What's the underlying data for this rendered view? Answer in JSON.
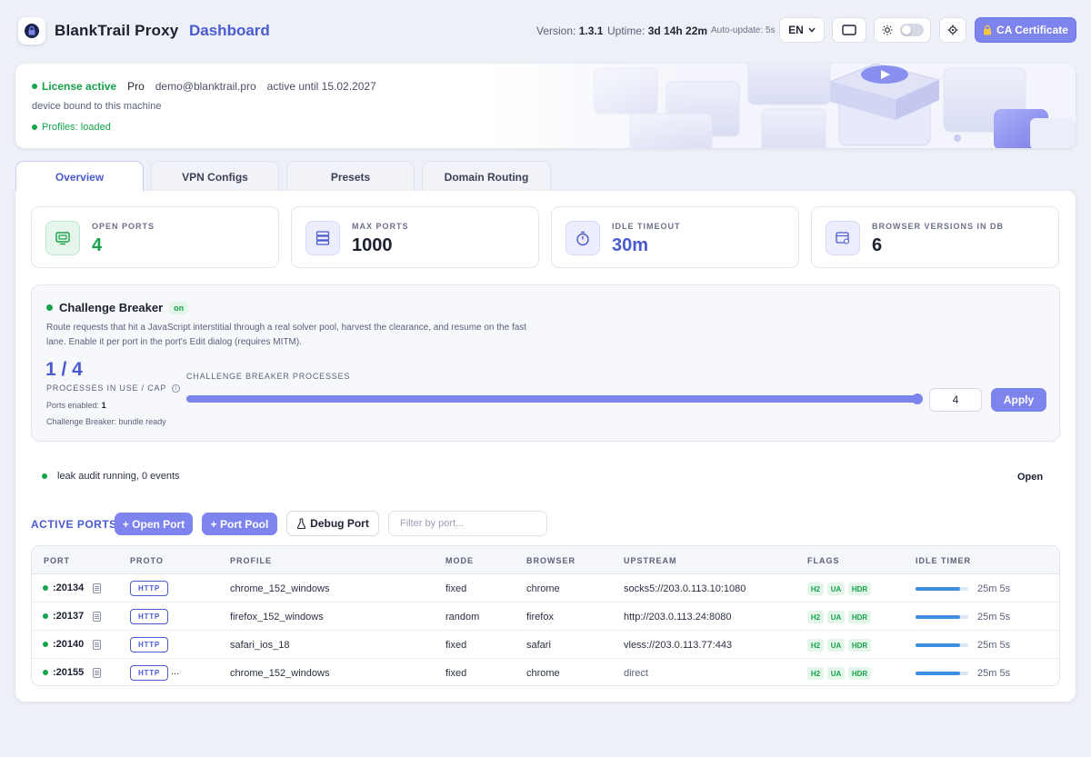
{
  "header": {
    "app_title": "BlankTrail Proxy",
    "app_subtitle": "Dashboard",
    "version_label": "Version:",
    "version_value": "1.3.1",
    "uptime_label": "Uptime:",
    "uptime_value": "3d 14h 22m",
    "autoupdate": "Auto-update: 5s",
    "language": "EN",
    "ca_button": "CA Certificate"
  },
  "license": {
    "status": "License active",
    "plan": "Pro",
    "email": "demo@blanktrail.pro",
    "expiry": "active until 15.02.2027",
    "bound": "device bound to this machine",
    "profiles": "Profiles: loaded"
  },
  "tabs": [
    {
      "label": "Overview",
      "active": true
    },
    {
      "label": "VPN Configs",
      "active": false
    },
    {
      "label": "Presets",
      "active": false
    },
    {
      "label": "Domain Routing",
      "active": false
    }
  ],
  "stats": [
    {
      "label": "OPEN PORTS",
      "value": "4",
      "icon": "monitor-icon"
    },
    {
      "label": "MAX PORTS",
      "value": "1000",
      "icon": "server-icon"
    },
    {
      "label": "IDLE TIMEOUT",
      "value": "30m",
      "icon": "stopwatch-icon"
    },
    {
      "label": "BROWSER VERSIONS IN DB",
      "value": "6",
      "icon": "browser-icon"
    }
  ],
  "challenge_breaker": {
    "title": "Challenge Breaker",
    "badge": "on",
    "description": "Route requests that hit a JavaScript interstitial through a real solver pool, harvest the clearance, and resume on the fast lane. Enable it per port in the port's Edit dialog (requires MITM).",
    "count": "1 / 4",
    "caption": "PROCESSES IN USE / CAP",
    "ports_enabled_label": "Ports enabled:",
    "ports_enabled_value": "1",
    "bundle_status": "Challenge Breaker: bundle ready",
    "processes_label": "CHALLENGE BREAKER PROCESSES",
    "processes_value": "4",
    "slider_fraction": 1.0,
    "apply": "Apply"
  },
  "leak_audit": {
    "status": "leak audit running, 0 events",
    "open": "Open"
  },
  "ports_toolbar": {
    "label": "ACTIVE PORTS",
    "open_port": "+ Open Port",
    "port_pool": "+ Port Pool",
    "debug_port": "Debug Port",
    "filter_placeholder": "Filter by port..."
  },
  "table": {
    "columns": [
      "PORT",
      "PROTO",
      "PROFILE",
      "MODE",
      "BROWSER",
      "UPSTREAM",
      "FLAGS",
      "IDLE TIMER"
    ],
    "rows": [
      {
        "port": ":20134",
        "proto": "HTTP",
        "extra": "",
        "profile": "chrome_152_windows",
        "mode": "fixed",
        "browser": "chrome",
        "upstream": "socks5://203.0.113.10:1080",
        "flags": [
          "H2",
          "UA",
          "HDR"
        ],
        "idle_fraction": 0.85,
        "idle": "25m 5s"
      },
      {
        "port": ":20137",
        "proto": "HTTP",
        "extra": "",
        "profile": "firefox_152_windows",
        "mode": "random",
        "browser": "firefox",
        "upstream": "http://203.0.113.24:8080",
        "flags": [
          "H2",
          "UA",
          "HDR"
        ],
        "idle_fraction": 0.85,
        "idle": "25m 5s"
      },
      {
        "port": ":20140",
        "proto": "HTTP",
        "extra": "",
        "profile": "safari_ios_18",
        "mode": "fixed",
        "browser": "safari",
        "upstream": "vless://203.0.113.77:443",
        "flags": [
          "H2",
          "UA",
          "HDR"
        ],
        "idle_fraction": 0.85,
        "idle": "25m 5s"
      },
      {
        "port": ":20155",
        "proto": "HTTP",
        "extra": "...",
        "profile": "chrome_152_windows",
        "mode": "fixed",
        "browser": "chrome",
        "upstream": "direct",
        "flags": [
          "H2",
          "UA",
          "HDR"
        ],
        "idle_fraction": 0.85,
        "idle": "25m 5s"
      }
    ]
  },
  "colors": {
    "accent": "#4a5bd0",
    "button": "#7d84ee",
    "success": "#16a34a",
    "background": "#eef0f7"
  }
}
